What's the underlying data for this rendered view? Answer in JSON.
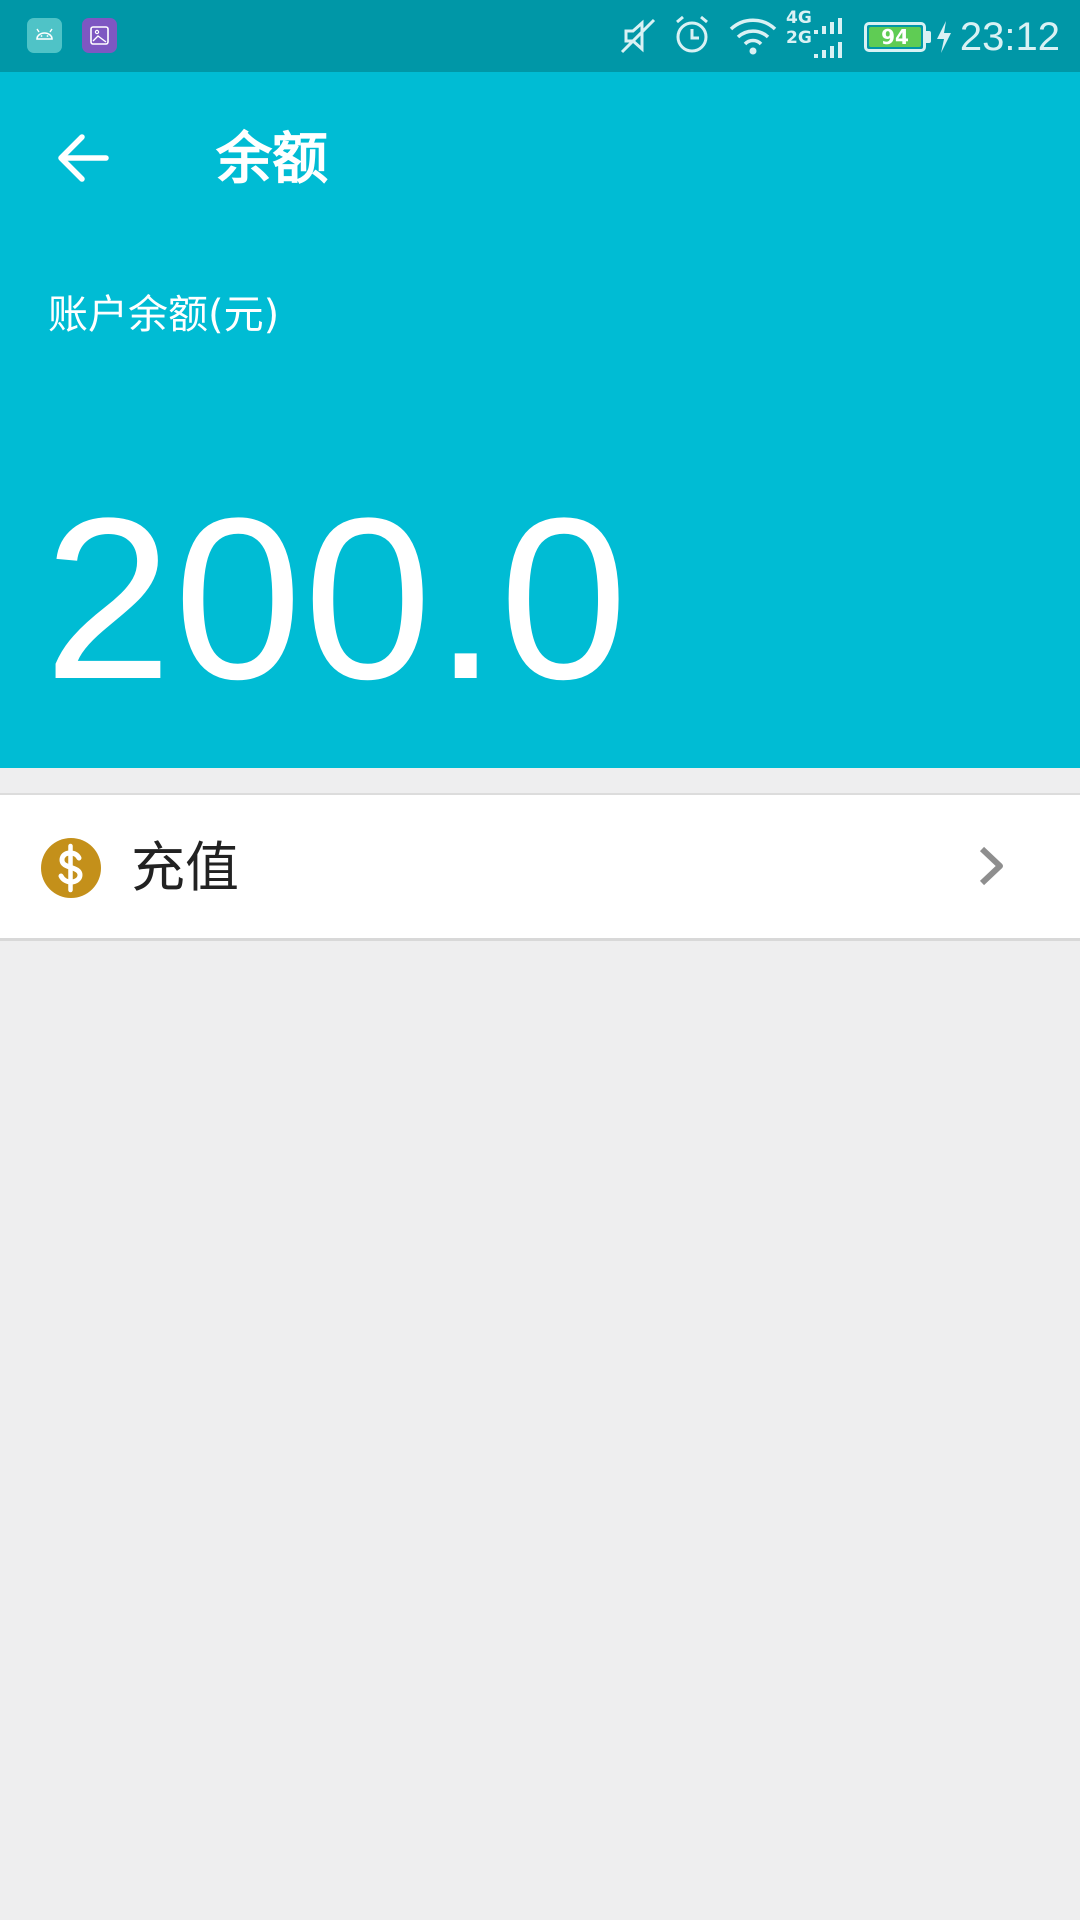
{
  "status_bar": {
    "time": "23:12",
    "battery_level": "94",
    "network_top": "4G",
    "network_bottom": "2G",
    "icons": [
      "android-notification-icon",
      "gallery-notification-icon",
      "mute-icon",
      "alarm-icon",
      "wifi-icon",
      "signal-icon",
      "battery-icon",
      "charging-icon"
    ]
  },
  "header": {
    "title": "余额",
    "back_icon": "arrow-left-icon",
    "background_color": "#00bcd4"
  },
  "balance": {
    "label": "账户余额(元)",
    "value": "200.0"
  },
  "recharge": {
    "label": "充值",
    "icon": "dollar-coin-icon",
    "icon_color": "#c4901a",
    "trailing_icon": "chevron-right-icon"
  }
}
